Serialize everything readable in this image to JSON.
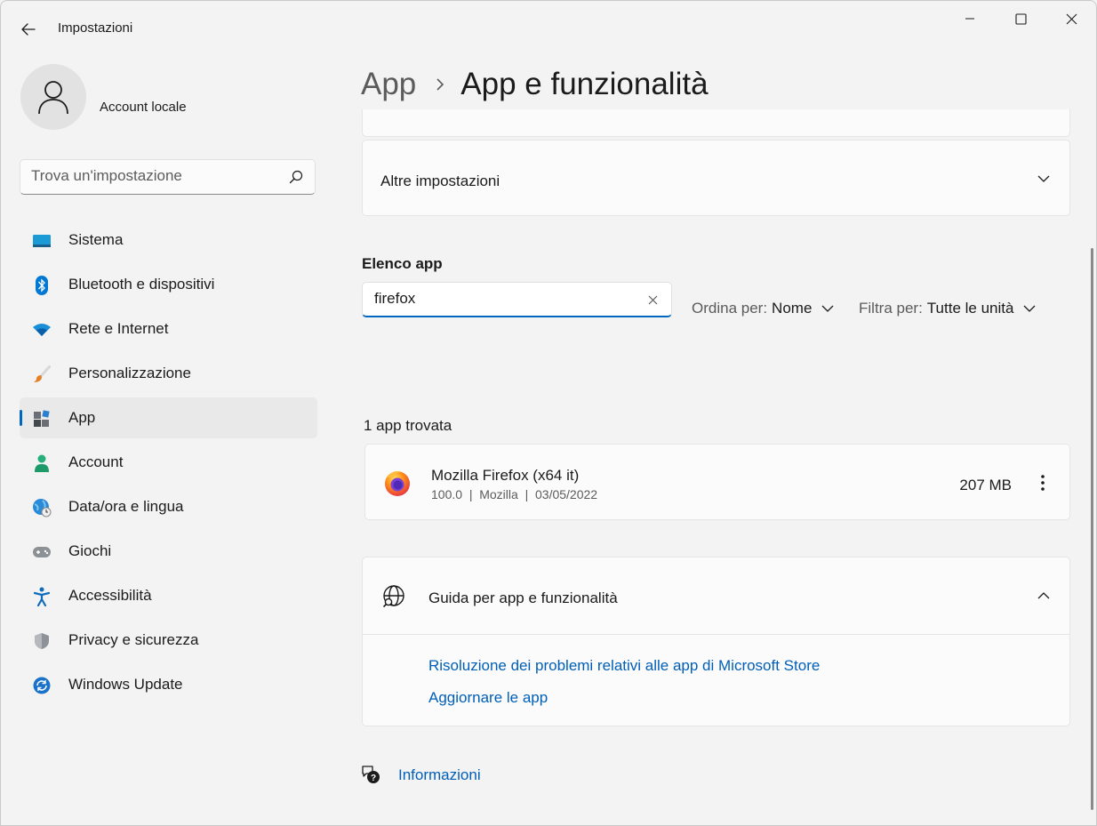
{
  "window": {
    "title": "Impostazioni",
    "controls": {
      "minimize": "minimize",
      "maximize": "maximize",
      "close": "close"
    }
  },
  "user": {
    "name": "Account locale"
  },
  "search": {
    "placeholder": "Trova un'impostazione"
  },
  "nav": {
    "items": [
      {
        "label": "Sistema",
        "icon": "monitor-icon"
      },
      {
        "label": "Bluetooth e dispositivi",
        "icon": "bluetooth-icon"
      },
      {
        "label": "Rete e Internet",
        "icon": "wifi-icon"
      },
      {
        "label": "Personalizzazione",
        "icon": "brush-icon"
      },
      {
        "label": "App",
        "icon": "apps-icon",
        "active": true
      },
      {
        "label": "Account",
        "icon": "person-icon"
      },
      {
        "label": "Data/ora e lingua",
        "icon": "globe-clock-icon"
      },
      {
        "label": "Giochi",
        "icon": "gamepad-icon"
      },
      {
        "label": "Accessibilità",
        "icon": "accessibility-icon"
      },
      {
        "label": "Privacy e sicurezza",
        "icon": "shield-icon"
      },
      {
        "label": "Windows Update",
        "icon": "update-icon"
      }
    ]
  },
  "breadcrumb": {
    "parent": "App",
    "current": "App e funzionalità"
  },
  "more_settings": {
    "label": "Altre impostazioni"
  },
  "app_list": {
    "section_label": "Elenco app",
    "filter_value": "firefox",
    "sort": {
      "label": "Ordina per:",
      "value": "Nome"
    },
    "filter": {
      "label": "Filtra per:",
      "value": "Tutte le unità"
    },
    "result_count": "1 app trovata",
    "apps": [
      {
        "name": "Mozilla Firefox (x64 it)",
        "version": "100.0",
        "publisher": "Mozilla",
        "date": "03/05/2022",
        "meta": "100.0  |  Mozilla  |  03/05/2022",
        "size": "207 MB"
      }
    ]
  },
  "help": {
    "title": "Guida per app e funzionalità",
    "links": [
      "Risoluzione dei problemi relativi alle app di Microsoft Store",
      "Aggiornare le app"
    ]
  },
  "info": {
    "label": "Informazioni"
  },
  "colors": {
    "accent": "#0067c0",
    "link": "#005fb8",
    "background": "#f3f3f3",
    "card": "#fbfbfb"
  }
}
